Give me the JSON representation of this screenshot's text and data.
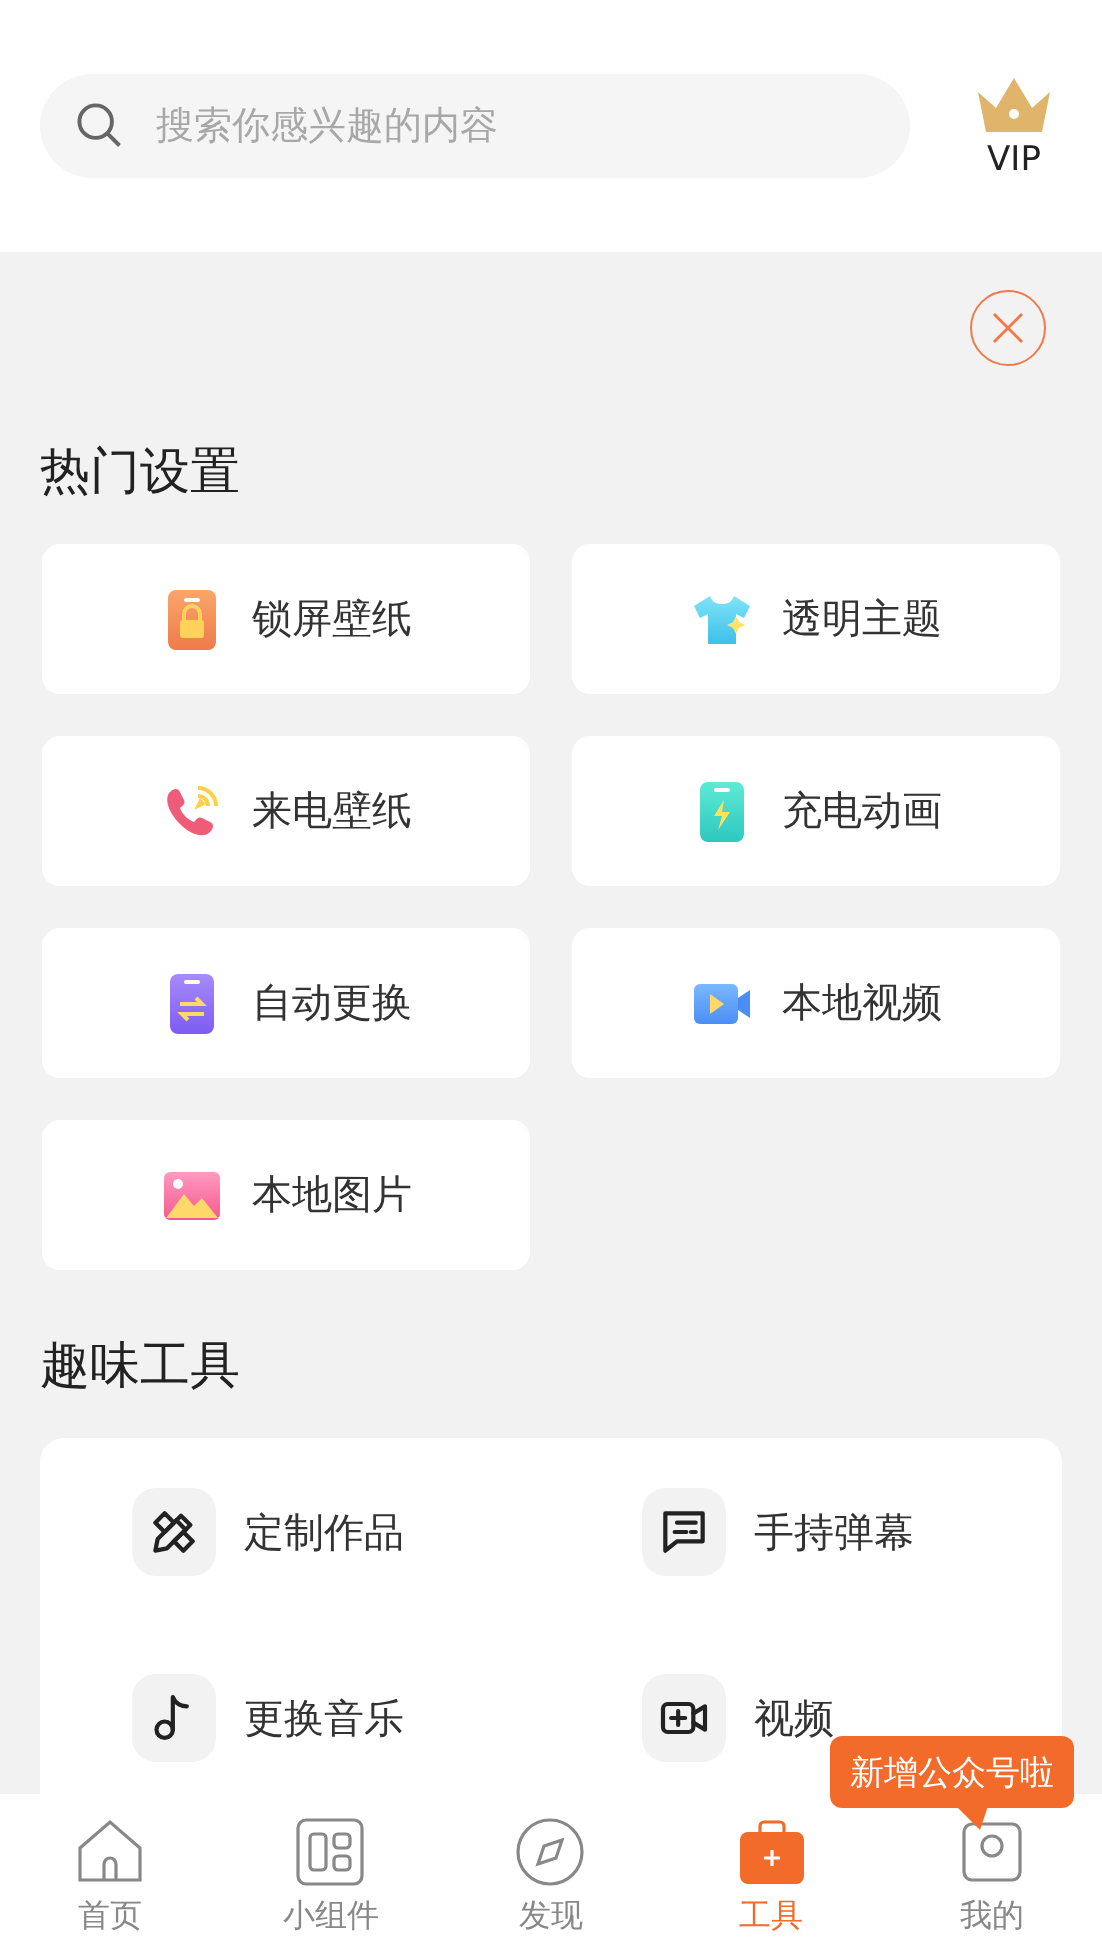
{
  "search": {
    "placeholder": "搜索你感兴趣的内容"
  },
  "vip": {
    "label": "VIP"
  },
  "sections": [
    {
      "title": "热门设置",
      "kind": "cards",
      "items": [
        {
          "label": "锁屏壁纸",
          "kind": "lock"
        },
        {
          "label": "透明主题",
          "kind": "shirt"
        },
        {
          "label": "来电壁纸",
          "kind": "phone"
        },
        {
          "label": "充电动画",
          "kind": "charge"
        },
        {
          "label": "自动更换",
          "kind": "swap"
        },
        {
          "label": "本地视频",
          "kind": "video"
        },
        {
          "label": "本地图片",
          "kind": "image"
        }
      ]
    },
    {
      "title": "趣味工具",
      "kind": "tools",
      "items": [
        {
          "label": "定制作品",
          "kind": "pencil"
        },
        {
          "label": "手持弹幕",
          "kind": "message"
        },
        {
          "label": "更换音乐",
          "kind": "music"
        },
        {
          "label": "视频",
          "kind": "videoplus"
        }
      ]
    }
  ],
  "tooltip": {
    "text": "新增公众号啦"
  },
  "nav": [
    {
      "label": "首页",
      "kind": "home",
      "selected": false
    },
    {
      "label": "小组件",
      "kind": "widget",
      "selected": false
    },
    {
      "label": "发现",
      "kind": "compass",
      "selected": false
    },
    {
      "label": "工具",
      "kind": "tools",
      "selected": true
    },
    {
      "label": "我的",
      "kind": "user",
      "selected": false
    }
  ]
}
